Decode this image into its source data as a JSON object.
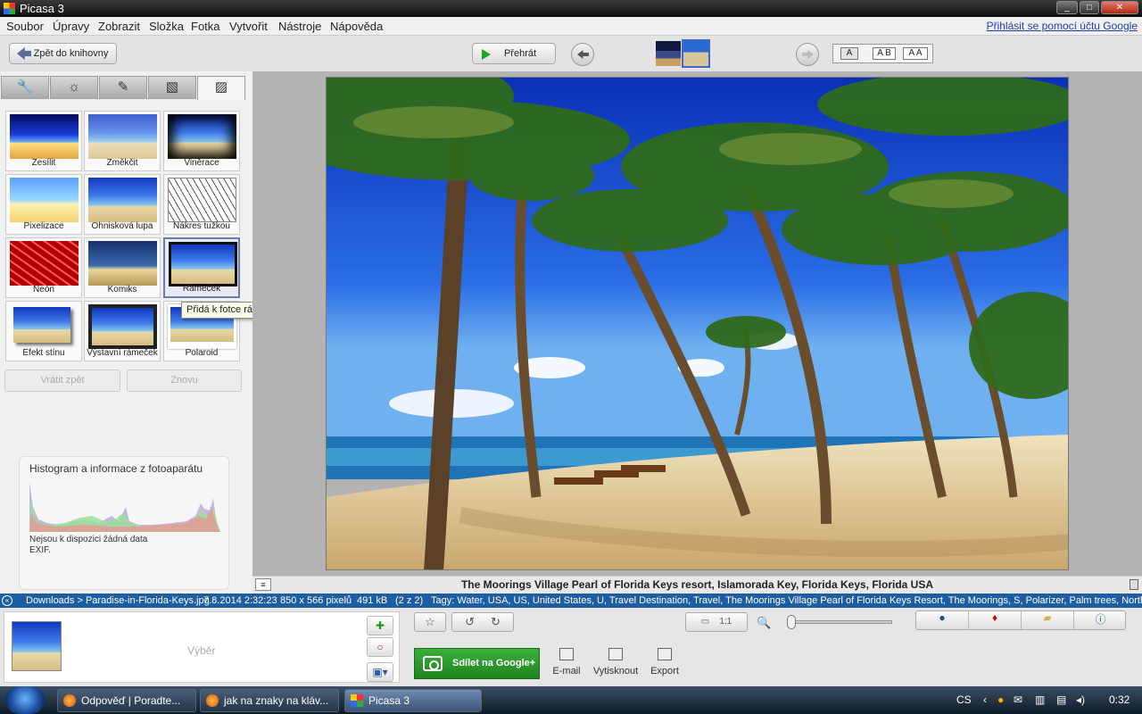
{
  "window": {
    "title": "Picasa 3"
  },
  "menu": {
    "items": [
      "Soubor",
      "Úpravy",
      "Zobrazit",
      "Složka",
      "Fotka",
      "Vytvořit",
      "Nástroje",
      "Nápověda"
    ],
    "signin": "Přihlásit se pomocí účtu Google"
  },
  "toolbar": {
    "back_label": "Zpět do knihovny",
    "play_label": "Přehrát",
    "text_sizes": [
      "A",
      "A B",
      "A A"
    ]
  },
  "panel": {
    "tabs": [
      "wrench-icon",
      "sun-icon",
      "brush-icon",
      "image-tone-icon",
      "frame-effects-icon"
    ],
    "effects": [
      "Zesílit",
      "Změkčit",
      "Viněrace",
      "Pixelizace",
      "Ohnisková lupa",
      "Nákres tužkou",
      "Neón",
      "Komiks",
      "Rámeček",
      "Efekt stínu",
      "Výstavní rámeček",
      "Polaroid"
    ],
    "tooltip": "Přidá k fotce rámeček",
    "undo_label": "Vrátit zpět",
    "redo_label": "Znovu",
    "histogram_title": "Histogram a informace z fotoaparátu",
    "exif_note": "Nejsou k dispozici žádná data EXIF."
  },
  "photo": {
    "caption": "The Moorings Village Pearl of Florida Keys resort, Islamorada Key, Florida Keys, Florida USA"
  },
  "status": {
    "path": "Downloads > Paradise-in-Florida-Keys.jpg",
    "date": "7.8.2014 2:32:23",
    "dims": "850 x 566 pixelů",
    "size": "491 kB",
    "count": "(2 z 2)",
    "tags": "Tagy: Water, USA, US, United States, U, Travel Destination, Travel, The Moorings Village Pearl of Florida Keys Resort, The Moorings, S, Polarizer, Palm trees, North America,"
  },
  "bottom": {
    "selection_label": "Výběr",
    "share_label": "Sdílet na Google+",
    "email_label": "E-mail",
    "print_label": "Vytisknout",
    "export_label": "Export",
    "zoom_1to1": "1:1"
  },
  "taskbar": {
    "tasks": [
      "Odpověď | Poradte...",
      "jak na znaky na kláv...",
      "Picasa 3"
    ],
    "lang": "CS",
    "clock": "0:32"
  }
}
